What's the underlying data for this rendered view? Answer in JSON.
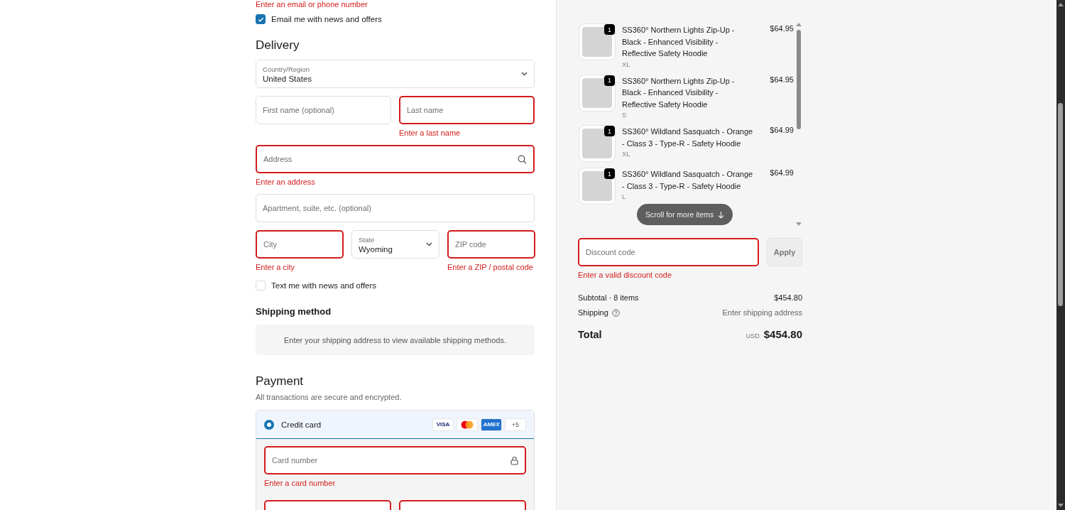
{
  "contact": {
    "error": "Enter an email or phone number",
    "email_optin": {
      "label": "Email me with news and offers",
      "checked": true
    }
  },
  "delivery": {
    "title": "Delivery",
    "rows": [
      [
        {
          "kind": "select",
          "label": "Country/Region",
          "value": "United States",
          "invalid": false
        }
      ],
      [
        {
          "kind": "text",
          "placeholder": "First name (optional)",
          "invalid": false
        },
        {
          "kind": "text",
          "placeholder": "Last name",
          "invalid": true,
          "error": "Enter a last name"
        }
      ],
      [
        {
          "kind": "search",
          "placeholder": "Address",
          "invalid": true,
          "error": "Enter an address"
        }
      ],
      [
        {
          "kind": "text",
          "placeholder": "Apartment, suite, etc. (optional)",
          "invalid": false
        }
      ],
      [
        {
          "kind": "text",
          "placeholder": "City",
          "invalid": true,
          "error": "Enter a city"
        },
        {
          "kind": "select",
          "label": "State",
          "value": "Wyoming",
          "invalid": false
        },
        {
          "kind": "text",
          "placeholder": "ZIP code",
          "invalid": true,
          "error": "Enter a ZIP / postal code"
        }
      ]
    ],
    "sms_optin": {
      "label": "Text me with news and offers",
      "checked": false
    }
  },
  "shipping_method": {
    "title": "Shipping method",
    "message": "Enter your shipping address to view available shipping methods."
  },
  "payment": {
    "title": "Payment",
    "subtitle": "All transactions are secure and encrypted.",
    "method": {
      "label": "Credit card",
      "selected": true
    },
    "brands": [
      {
        "kind": "visa",
        "text": "VISA"
      },
      {
        "kind": "mastercard"
      },
      {
        "kind": "amex",
        "text": "AMEX"
      },
      {
        "kind": "more",
        "text": "+5"
      }
    ],
    "card_rows": [
      [
        {
          "kind": "lock",
          "placeholder": "Card number",
          "invalid": true,
          "error": "Enter a card number"
        }
      ],
      [
        {
          "kind": "text",
          "invalid": true
        },
        {
          "kind": "text",
          "invalid": true
        }
      ]
    ]
  },
  "summary": {
    "items": [
      {
        "quantity": "1",
        "title": "SS360° Northern Lights Zip-Up - Black - Enhanced Visibility - Reflective Safety Hoodie",
        "variant": "XL",
        "price": "$64.95"
      },
      {
        "quantity": "1",
        "title": "SS360° Northern Lights Zip-Up - Black - Enhanced Visibility - Reflective Safety Hoodie",
        "variant": "S",
        "price": "$64.95"
      },
      {
        "quantity": "1",
        "title": "SS360° Wildland Sasquatch - Orange - Class 3 - Type-R - Safety Hoodie",
        "variant": "XL",
        "price": "$64.99"
      },
      {
        "quantity": "1",
        "title": "SS360° Wildland Sasquatch - Orange - Class 3 - Type-R - Safety Hoodie",
        "variant": "L",
        "price": "$64.99"
      }
    ],
    "scroll_hint": "Scroll for more items",
    "discount": {
      "placeholder": "Discount code",
      "invalid": true,
      "error": "Enter a valid discount code",
      "button": "Apply"
    },
    "subtotal": {
      "label": "Subtotal · 8 items",
      "value": "$454.80"
    },
    "shipping": {
      "label": "Shipping",
      "value": "Enter shipping address"
    },
    "total": {
      "label": "Total",
      "currency": "USD",
      "value": "$454.80"
    }
  }
}
